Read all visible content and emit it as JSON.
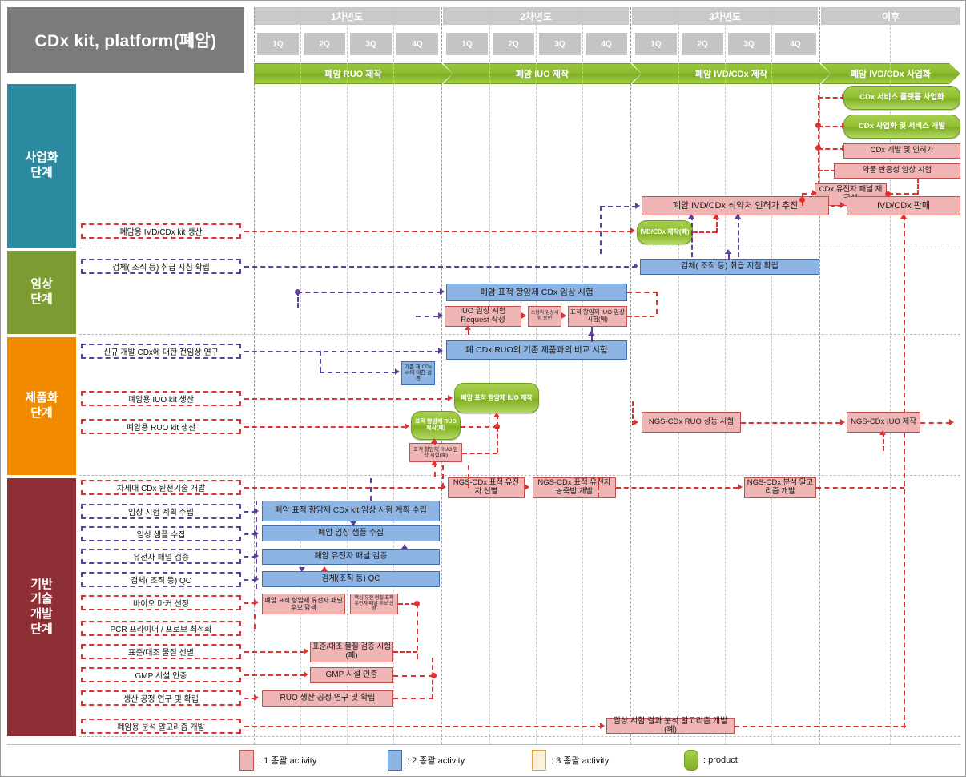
{
  "header": {
    "title": "CDx kit, platform(폐암)",
    "years": [
      "1차년도",
      "2차년도",
      "3차년도",
      "이후"
    ],
    "quarters": [
      "1Q",
      "2Q",
      "3Q",
      "4Q",
      "1Q",
      "2Q",
      "3Q",
      "4Q",
      "1Q",
      "2Q",
      "3Q",
      "4Q"
    ],
    "phases": [
      "폐암 RUO 제작",
      "폐암 IUO 제작",
      "폐암 IVD/CDx 제작",
      "폐암 IVD/CDx 사업화"
    ]
  },
  "stages": [
    {
      "key": "biz",
      "label": "사업화\n단계",
      "color": "#2b8aa0"
    },
    {
      "key": "clin",
      "label": "임상\n단계",
      "color": "#7d9b33"
    },
    {
      "key": "prod",
      "label": "제품화\n단계",
      "color": "#f28a00"
    },
    {
      "key": "base",
      "label": "기반\n기술\n개발\n단계",
      "color": "#8e2f35"
    }
  ],
  "row_labels": {
    "biz_1": "폐암용 IVD/CDx kit 생산",
    "clin_1": "검체( 조직 등) 취급 지침 확립",
    "prod_1": "신규 개발 CDx에 대한 전임상 연구",
    "prod_2": "폐암용 IUO kit 생산",
    "prod_3": "폐암용 RUO kit 생산",
    "base_1": "차세대 CDx 원천기술 개발",
    "base_2": "임상 시험 계획 수립",
    "base_3": "임상 샘플 수집",
    "base_4": "유전자 패널 검증",
    "base_5": "검체( 조직 등) QC",
    "base_6": "바이오 마커 선정",
    "base_7": "PCR 프라이머 / 프로브 최적화",
    "base_8": "표준/대조 물질 선별",
    "base_9": "GMP 시설 인증",
    "base_10": "생산 공정 연구 및 확립",
    "base_11": "폐암용 분석 알고리즘 개발"
  },
  "nodes": {
    "biz_service_platform": "CDx 서비스 플랫폼 사업화",
    "biz_cdx_service_dev": "CDx 사업화 및 서비스 개발",
    "biz_cdx_dev_approval": "CDx 개발 및 인허가",
    "biz_drug_response_trial": "약물 반응성 임상 시험",
    "biz_panel_reconfig": "CDx 유전자 패널 재구성",
    "biz_mfds_approval": "폐암 IVD/CDx 식약처 인허가 추진",
    "biz_ivd_sales": "IVD/CDx 판매",
    "biz_ivd_product": "IVD/CDx 제작(폐)",
    "clin_specimen_guide": "검체( 조직 등) 취급 지침 확립",
    "clin_target_trial": "폐암 표적 항암제 CDx 임상 시험",
    "clin_iuo_request": "IUO 임상 시험 Request 작성",
    "clin_iuo_approval": "소형의 임상시험 승인",
    "clin_iuo_trial": "표적 항암제 IUO 임상 시험(폐)",
    "prod_compare_test": "폐 CDx RUO의 기존 제품과의 비교 시험",
    "prod_existing_verify": "기존 제 CDx kit에 대한 검증",
    "prod_iuo_product": "폐암 표적 항암제 IUO 제작",
    "prod_ruo_product": "표적 항암제 RUO 제작(폐)",
    "prod_ruo_trial": "표적 항암제 RUO 임상 시험(폐)",
    "prod_ngs_ruo_perf": "NGS-CDx RUO 성능 시험",
    "prod_ngs_iuo_make": "NGS-CDx IUO 제작",
    "base_plan": "폐암 표적 항암제 CDx kit 임상 시험 계획 수립",
    "base_sample": "폐암 임상 샘플 수집",
    "base_panel": "폐암 유전자 패널 검증",
    "base_qc": "검체(조직 등) QC",
    "base_marker_search": "폐암 표적 항암제 유전자 패널 후보 탐색",
    "base_marker_select": "핵심 유전 형질 표적 유전자 패널 후보 선정",
    "base_std_test": "표준/대조 물질 검증 시험(폐)",
    "base_gmp": "GMP 시설 인증",
    "base_ruo_process": "RUO 생산 공정 연구 및 확립",
    "base_ngs_target_gene": "NGS-CDx 표적 유전자 선별",
    "base_ngs_enrich": "NGS-CDx 표적 유전자 농축법 개발",
    "base_ngs_algo": "NGS-CDx 분석 알고리즘 개발",
    "base_trial_algo": "임상 시험 결과 분석 알고리즘 개발(폐)"
  },
  "legend": [
    {
      "swatch": "pink",
      "label": ": 1 종괄 activity"
    },
    {
      "swatch": "blue",
      "label": ": 2 종괄 activity"
    },
    {
      "swatch": "cream",
      "label": ": 3 종괄 activity"
    },
    {
      "swatch": "green",
      "label": ": product"
    }
  ],
  "colors": {
    "stage_biz": "#2b8aa0",
    "stage_clin": "#7d9b33",
    "stage_prod": "#f28a00",
    "stage_base": "#8e2f35",
    "activity_1": "#efb5b5",
    "activity_2": "#8db4e2",
    "activity_3": "#fdf1da",
    "product": "#93c134",
    "connector_red": "#e03030",
    "connector_purple": "#5f3f9e",
    "header_gray": "#7b7b7b"
  }
}
